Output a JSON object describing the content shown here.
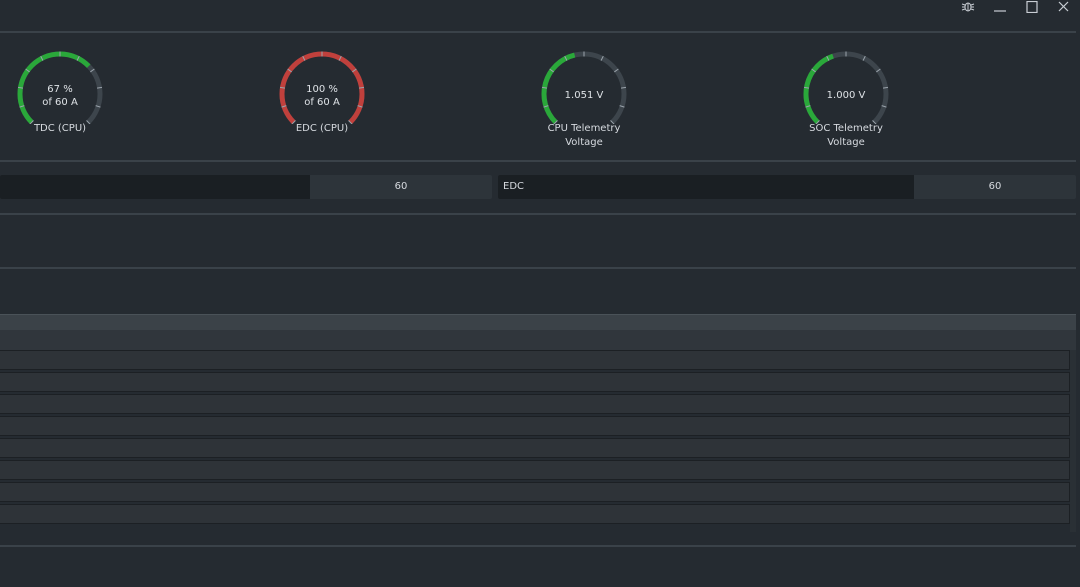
{
  "window": {
    "controls": [
      {
        "name": "bug-report-icon"
      },
      {
        "name": "minimize-icon"
      },
      {
        "name": "maximize-icon"
      },
      {
        "name": "close-icon"
      }
    ]
  },
  "colors": {
    "green": "#2aa83a",
    "red": "#c0403c",
    "track": "#3d454c"
  },
  "gauges": [
    {
      "id": "tdc",
      "line1": "67 %",
      "line2": "of 60 A",
      "label1": "TDC (CPU)",
      "label2": "",
      "fraction": 0.67,
      "color": "green"
    },
    {
      "id": "edc",
      "line1": "100 %",
      "line2": "of 60 A",
      "label1": "EDC (CPU)",
      "label2": "",
      "fraction": 1.0,
      "color": "red"
    },
    {
      "id": "cpu-voltage",
      "line1": "1.051 V",
      "line2": "",
      "label1": "CPU Telemetry",
      "label2": "Voltage",
      "fraction": 0.45,
      "color": "green"
    },
    {
      "id": "soc-voltage",
      "line1": "1.000 V",
      "line2": "",
      "label1": "SOC Telemetry",
      "label2": "Voltage",
      "fraction": 0.43,
      "color": "green"
    }
  ],
  "limits": [
    {
      "id": "tdc-limit",
      "label": "",
      "value": "60",
      "fill": 0.63
    },
    {
      "id": "edc-limit",
      "label": "EDC",
      "value": "60",
      "fill": 0.72
    }
  ],
  "table": {
    "row_count": 8
  }
}
